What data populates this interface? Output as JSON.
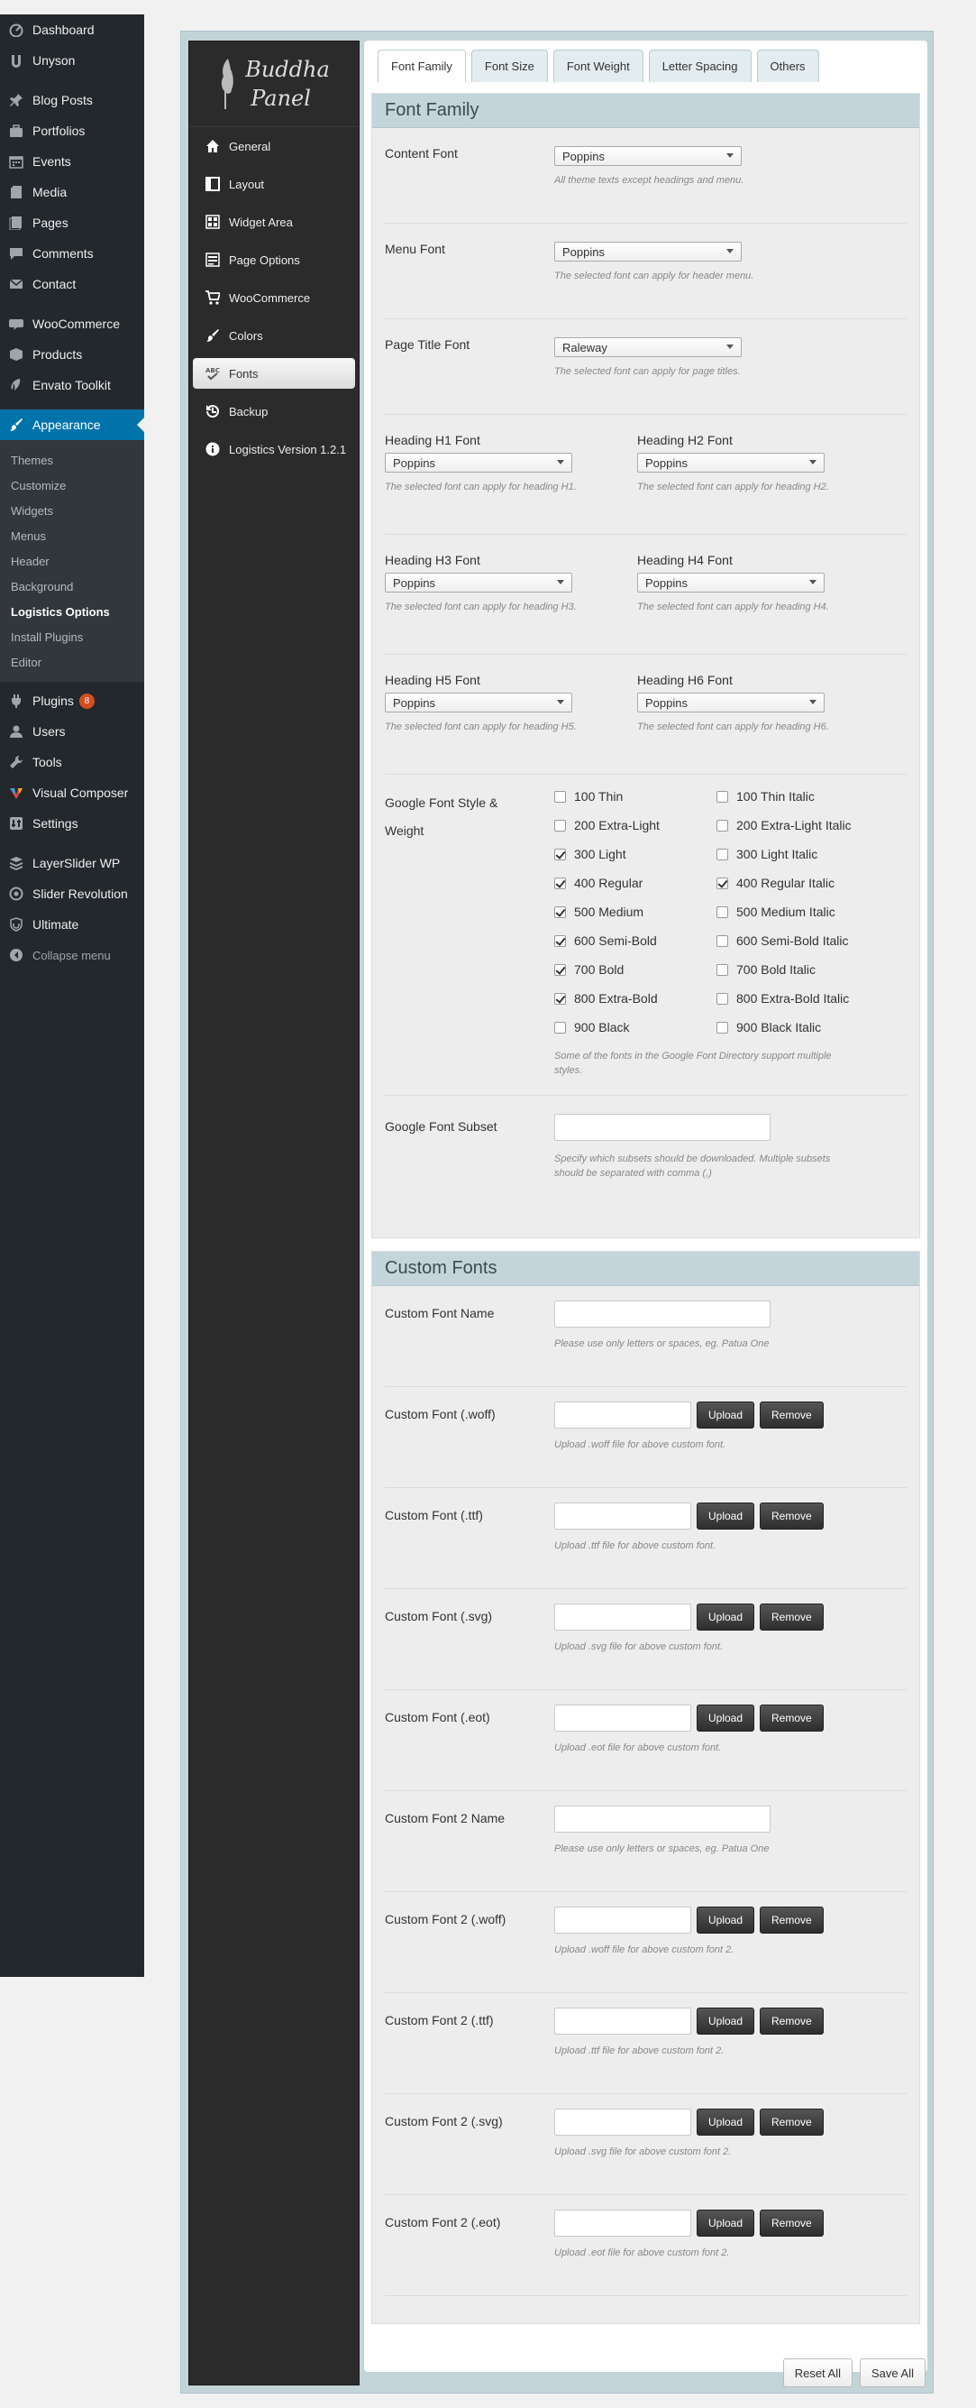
{
  "wp_menu": {
    "items": [
      {
        "label": "Dashboard",
        "icon": "dashboard-icon"
      },
      {
        "label": "Unyson",
        "icon": "unyson-icon"
      },
      {
        "sep": true
      },
      {
        "label": "Blog Posts",
        "icon": "pin-icon"
      },
      {
        "label": "Portfolios",
        "icon": "portfolio-icon"
      },
      {
        "label": "Events",
        "icon": "calendar-icon"
      },
      {
        "label": "Media",
        "icon": "media-icon"
      },
      {
        "label": "Pages",
        "icon": "pages-icon"
      },
      {
        "label": "Comments",
        "icon": "comments-icon"
      },
      {
        "label": "Contact",
        "icon": "mail-icon"
      },
      {
        "sep": true
      },
      {
        "label": "WooCommerce",
        "icon": "woocommerce-icon"
      },
      {
        "label": "Products",
        "icon": "products-icon"
      },
      {
        "label": "Envato Toolkit",
        "icon": "envato-icon"
      },
      {
        "sep": true
      },
      {
        "label": "Appearance",
        "icon": "appearance-icon",
        "active": true
      }
    ],
    "appearance_sub": [
      "Themes",
      "Customize",
      "Widgets",
      "Menus",
      "Header",
      "Background",
      "Logistics Options",
      "Install Plugins",
      "Editor"
    ],
    "current_sub": "Logistics Options",
    "items_after": [
      {
        "label": "Plugins",
        "icon": "plugins-icon",
        "badge": "8"
      },
      {
        "label": "Users",
        "icon": "users-icon"
      },
      {
        "label": "Tools",
        "icon": "tools-icon"
      },
      {
        "label": "Visual Composer",
        "icon": "visual-composer-icon"
      },
      {
        "label": "Settings",
        "icon": "settings-icon"
      },
      {
        "sep": true
      },
      {
        "label": "LayerSlider WP",
        "icon": "layerslider-icon"
      },
      {
        "label": "Slider Revolution",
        "icon": "slider-revolution-icon"
      },
      {
        "label": "Ultimate",
        "icon": "ultimate-icon"
      },
      {
        "label": "Collapse menu",
        "icon": "collapse-icon",
        "collapse": true
      }
    ]
  },
  "theme_panel": {
    "logo_line1": "Buddha",
    "logo_line2": "Panel",
    "nav": [
      {
        "label": "General",
        "icon": "home-icon"
      },
      {
        "label": "Layout",
        "icon": "layout-icon"
      },
      {
        "label": "Widget Area",
        "icon": "widget-area-icon"
      },
      {
        "label": "Page Options",
        "icon": "page-options-icon"
      },
      {
        "label": "WooCommerce",
        "icon": "cart-icon"
      },
      {
        "label": "Colors",
        "icon": "brush-icon"
      },
      {
        "label": "Fonts",
        "icon": "fonts-icon",
        "active": true
      },
      {
        "label": "Backup",
        "icon": "backup-icon"
      },
      {
        "label": "Logistics Version 1.2.1",
        "icon": "info-icon"
      }
    ]
  },
  "tabs": [
    "Font Family",
    "Font Size",
    "Font Weight",
    "Letter Spacing",
    "Others"
  ],
  "font_family": {
    "title": "Font Family",
    "content_font": {
      "label": "Content Font",
      "value": "Poppins",
      "desc": "All theme texts except headings and menu."
    },
    "menu_font": {
      "label": "Menu Font",
      "value": "Poppins",
      "desc": "The selected font can apply for header menu."
    },
    "page_title_font": {
      "label": "Page Title Font",
      "value": "Raleway",
      "desc": "The selected font can apply for page titles."
    },
    "headings": [
      {
        "label": "Heading H1 Font",
        "value": "Poppins",
        "desc": "The selected font can apply for heading H1."
      },
      {
        "label": "Heading H2 Font",
        "value": "Poppins",
        "desc": "The selected font can apply for heading H2."
      },
      {
        "label": "Heading H3 Font",
        "value": "Poppins",
        "desc": "The selected font can apply for heading H3."
      },
      {
        "label": "Heading H4 Font",
        "value": "Poppins",
        "desc": "The selected font can apply for heading H4."
      },
      {
        "label": "Heading H5 Font",
        "value": "Poppins",
        "desc": "The selected font can apply for heading H5."
      },
      {
        "label": "Heading H6 Font",
        "value": "Poppins",
        "desc": "The selected font can apply for heading H6."
      }
    ],
    "style_weight": {
      "label_line1": "Google Font Style &",
      "label_line2": "Weight",
      "left": [
        {
          "label": "100 Thin",
          "checked": false
        },
        {
          "label": "200 Extra-Light",
          "checked": false
        },
        {
          "label": "300 Light",
          "checked": true
        },
        {
          "label": "400 Regular",
          "checked": true
        },
        {
          "label": "500 Medium",
          "checked": true
        },
        {
          "label": "600 Semi-Bold",
          "checked": true
        },
        {
          "label": "700 Bold",
          "checked": true
        },
        {
          "label": "800 Extra-Bold",
          "checked": true
        },
        {
          "label": "900 Black",
          "checked": false
        }
      ],
      "right": [
        {
          "label": "100 Thin Italic",
          "checked": false
        },
        {
          "label": "200 Extra-Light Italic",
          "checked": false
        },
        {
          "label": "300 Light Italic",
          "checked": false
        },
        {
          "label": "400 Regular Italic",
          "checked": true
        },
        {
          "label": "500 Medium Italic",
          "checked": false
        },
        {
          "label": "600 Semi-Bold Italic",
          "checked": false
        },
        {
          "label": "700 Bold Italic",
          "checked": false
        },
        {
          "label": "800 Extra-Bold Italic",
          "checked": false
        },
        {
          "label": "900 Black Italic",
          "checked": false
        }
      ],
      "desc_line1": "Some of the fonts in the Google Font Directory support multiple",
      "desc_line2": "styles."
    },
    "subset": {
      "label": "Google Font Subset",
      "value": "",
      "desc_line1": "Specify which subsets should be downloaded. Multiple subsets",
      "desc_line2": "should be separated with comma (,)"
    }
  },
  "custom_fonts": {
    "title": "Custom Fonts",
    "upload_label": "Upload",
    "remove_label": "Remove",
    "rows": [
      {
        "label": "Custom Font Name",
        "type": "text",
        "desc": "Please use only letters or spaces, eg. Patua One"
      },
      {
        "label": "Custom Font (.woff)",
        "type": "upload",
        "desc": "Upload .woff file for above custom font."
      },
      {
        "label": "Custom Font (.ttf)",
        "type": "upload",
        "desc": "Upload .ttf file for above custom font."
      },
      {
        "label": "Custom Font (.svg)",
        "type": "upload",
        "desc": "Upload .svg file for above custom font."
      },
      {
        "label": "Custom Font (.eot)",
        "type": "upload",
        "desc": "Upload .eot file for above custom font."
      },
      {
        "label": "Custom Font 2 Name",
        "type": "text",
        "desc": "Please use only letters or spaces, eg. Patua One"
      },
      {
        "label": "Custom Font 2 (.woff)",
        "type": "upload",
        "desc": "Upload .woff file for above custom font 2."
      },
      {
        "label": "Custom Font 2 (.ttf)",
        "type": "upload",
        "desc": "Upload .ttf file for above custom font 2."
      },
      {
        "label": "Custom Font 2 (.svg)",
        "type": "upload",
        "desc": "Upload .svg file for above custom font 2."
      },
      {
        "label": "Custom Font 2 (.eot)",
        "type": "upload",
        "desc": "Upload .eot file for above custom font 2."
      }
    ]
  },
  "footer": {
    "reset_label": "Reset All",
    "save_label": "Save All"
  },
  "colors": {
    "wp_sidebar": "#23282d",
    "wp_active": "#0073aa",
    "section_head": "#c3d5da",
    "theme_sidebar": "#2b2b2b"
  }
}
